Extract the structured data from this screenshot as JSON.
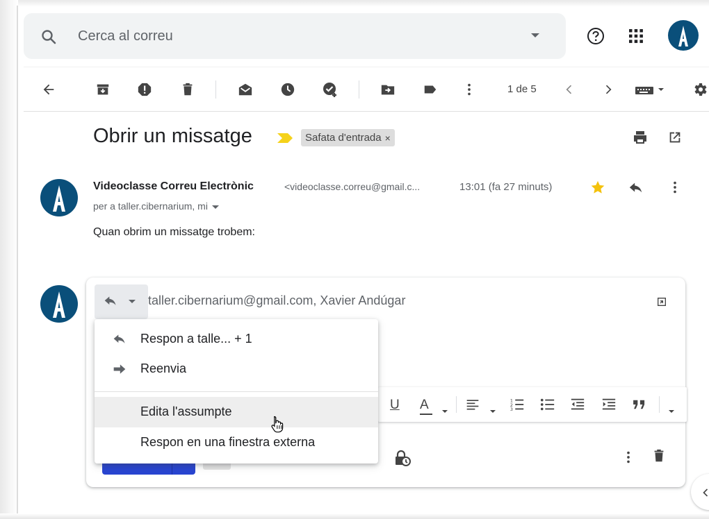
{
  "search": {
    "placeholder": "Cerca al correu"
  },
  "toolbar": {
    "page_count": "1 de 5"
  },
  "message": {
    "subject": "Obrir un missatge",
    "label": "Safata d'entrada",
    "label_close": "×",
    "sender_name": "Videoclasse Correu Electrònic",
    "sender_email": "<videoclasse.correu@gmail.c...",
    "time": "13:01 (fa 27 minuts)",
    "recipients": "per a taller.cibernarium, mi",
    "body": "Quan obrim un missatge trobem:"
  },
  "reply": {
    "recipients": "taller.cibernarium@gmail.com, Xavier Andúgar"
  },
  "format_bar": {
    "underline": "U",
    "text_color": "A"
  },
  "reply_menu": {
    "items": [
      {
        "label": "Respon a talle... + 1",
        "icon": "reply-icon"
      },
      {
        "label": "Reenvia",
        "icon": "forward-icon"
      },
      {
        "label": "Edita l'assumpte",
        "icon": ""
      },
      {
        "label": "Respon en una finestra externa",
        "icon": ""
      }
    ]
  },
  "colors": {
    "accent_blue": "#2945d1",
    "avatar_bg": "#0a4f7a",
    "star": "#f4c20d",
    "importance": "#f5d21b"
  }
}
